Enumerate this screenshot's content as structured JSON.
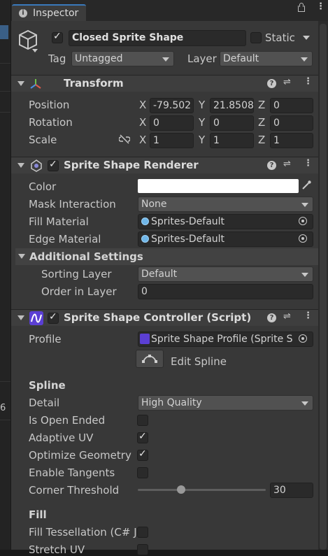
{
  "tab": {
    "title": "Inspector"
  },
  "object": {
    "name": "Closed Sprite Shape",
    "active": true,
    "static_label": "Static",
    "tag_label": "Tag",
    "tag_value": "Untagged",
    "layer_label": "Layer",
    "layer_value": "Default"
  },
  "transform": {
    "title": "Transform",
    "position": {
      "label": "Position",
      "x": "-79.502",
      "y": "21.8508",
      "z": "0"
    },
    "rotation": {
      "label": "Rotation",
      "x": "0",
      "y": "0",
      "z": "0"
    },
    "scale": {
      "label": "Scale",
      "x": "1",
      "y": "1",
      "z": "1"
    },
    "axis": {
      "x": "X",
      "y": "Y",
      "z": "Z"
    }
  },
  "renderer": {
    "title": "Sprite Shape Renderer",
    "enabled": true,
    "color_label": "Color",
    "color_value": "#ffffff",
    "mask_label": "Mask Interaction",
    "mask_value": "None",
    "fill_material_label": "Fill Material",
    "fill_material_value": "Sprites-Default",
    "edge_material_label": "Edge Material",
    "edge_material_value": "Sprites-Default",
    "additional_label": "Additional Settings",
    "sorting_layer_label": "Sorting Layer",
    "sorting_layer_value": "Default",
    "order_label": "Order in Layer",
    "order_value": "0"
  },
  "controller": {
    "title": "Sprite Shape Controller (Script)",
    "enabled": true,
    "profile_label": "Profile",
    "profile_value": "Sprite Shape Profile (Sprite S",
    "edit_spline_label": "Edit Spline",
    "spline_heading": "Spline",
    "detail_label": "Detail",
    "detail_value": "High Quality",
    "open_ended_label": "Is Open Ended",
    "open_ended": false,
    "adaptive_uv_label": "Adaptive UV",
    "adaptive_uv": true,
    "optimize_label": "Optimize Geometry",
    "optimize": true,
    "tangents_label": "Enable Tangents",
    "tangents": false,
    "corner_label": "Corner Threshold",
    "corner_value": "30",
    "corner_slider_fraction": 0.34,
    "fill_heading": "Fill",
    "tessellation_label": "Fill Tessellation (C# J",
    "tessellation": false,
    "stretch_label": "Stretch UV",
    "stretch": false
  },
  "left_strip_value": "6",
  "colors": {
    "accent": "#3a79bb",
    "panel": "#383838",
    "header": "#3e3e3e"
  }
}
